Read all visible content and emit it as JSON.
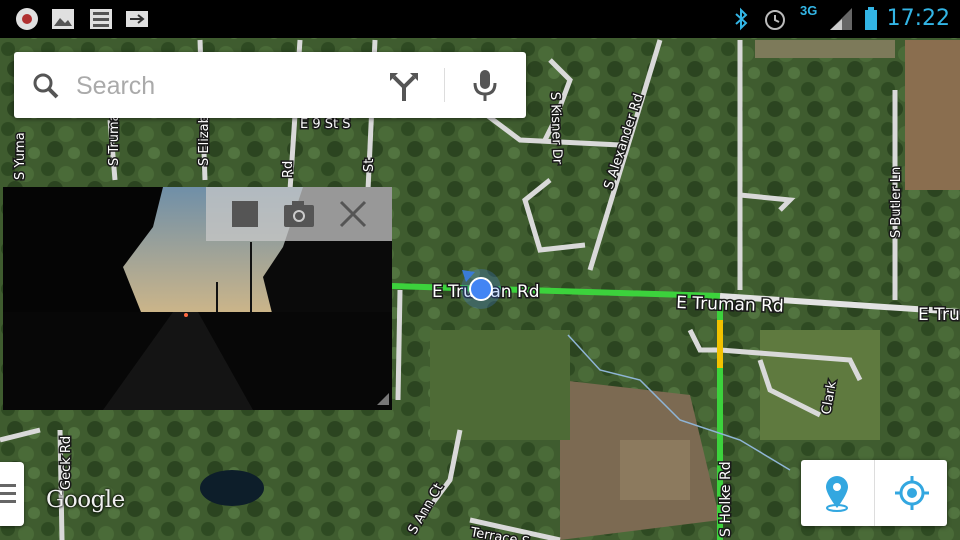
{
  "status_bar": {
    "time": "17:22",
    "network": "3G",
    "icons": [
      "record-icon",
      "gallery-icon",
      "list-icon",
      "arrow-icon",
      "bluetooth-icon",
      "alarm-icon",
      "signal-icon",
      "battery-icon"
    ]
  },
  "search": {
    "placeholder": "Search",
    "icons": [
      "search-icon",
      "directions-icon",
      "microphone-icon"
    ]
  },
  "map": {
    "attribution": "Google",
    "location_dot_color": "#4285f4",
    "traffic_colors": {
      "free": "#3cd23c",
      "slow": "#f2c200"
    },
    "street_labels": [
      "E Truman Rd",
      "E Truman Rd",
      "E Tru",
      "S Kisner Dr",
      "S Alexander Rd",
      "S Butler Ln",
      "S Holke Rd",
      "Clark",
      "S Yuma",
      "S Truma",
      "S Elizab",
      "Rd",
      "E 9 St S",
      "St",
      "Geck Rd",
      "S Ann Ct",
      "Terrace S"
    ]
  },
  "street_view": {
    "controls": [
      "stop-icon",
      "camera-icon",
      "close-icon"
    ]
  },
  "map_controls": {
    "icons": [
      "place-marker-icon",
      "my-location-icon"
    ]
  },
  "menu_tab": {
    "icon": "menu-icon"
  }
}
